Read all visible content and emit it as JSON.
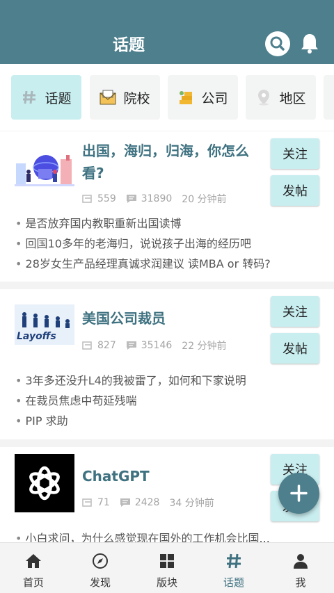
{
  "header": {
    "title": "话题"
  },
  "tabs": [
    {
      "label": "话题",
      "icon": "hash-icon",
      "active": true
    },
    {
      "label": "院校",
      "icon": "school-envelope-icon",
      "active": false
    },
    {
      "label": "公司",
      "icon": "money-stack-icon",
      "active": false
    },
    {
      "label": "地区",
      "icon": "location-pin-icon",
      "active": false
    }
  ],
  "topics": [
    {
      "title": "出国，海归，归海，你怎么看?",
      "followers": "559",
      "posts": "31890",
      "time": "20 分钟前",
      "follow_label": "关注",
      "post_label": "发帖",
      "threads": [
        "是否放弃国内教职重新出国读博",
        "回国10多年的老海归，说说孩子出海的经历吧",
        "28岁女生产品经理真诚求润建议 读MBA or 转码?"
      ]
    },
    {
      "title": "美国公司裁员",
      "thumb_text": "Layoffs",
      "followers": "827",
      "posts": "35146",
      "time": "22 分钟前",
      "follow_label": "关注",
      "post_label": "发帖",
      "threads": [
        "3年多还没升L4的我被雷了，如何和下家说明",
        "在裁员焦虑中苟延残喘",
        "PIP 求助"
      ]
    },
    {
      "title": "ChatGPT",
      "followers": "71",
      "posts": "2428",
      "time": "34 分钟前",
      "follow_label": "关注",
      "post_label": "发帖",
      "threads": [
        "小白求问，为什么感觉现在国外的工作机会比国..."
      ]
    }
  ],
  "bottom_nav": [
    {
      "label": "首页",
      "icon": "home-icon",
      "active": false
    },
    {
      "label": "发现",
      "icon": "compass-icon",
      "active": false
    },
    {
      "label": "版块",
      "icon": "grid-icon",
      "active": false
    },
    {
      "label": "话题",
      "icon": "hash-icon",
      "active": true
    },
    {
      "label": "我",
      "icon": "person-icon",
      "active": false
    }
  ],
  "colors": {
    "primary": "#4d7f8d",
    "accent_light": "#c9eef0",
    "title_text": "#3f7281"
  }
}
